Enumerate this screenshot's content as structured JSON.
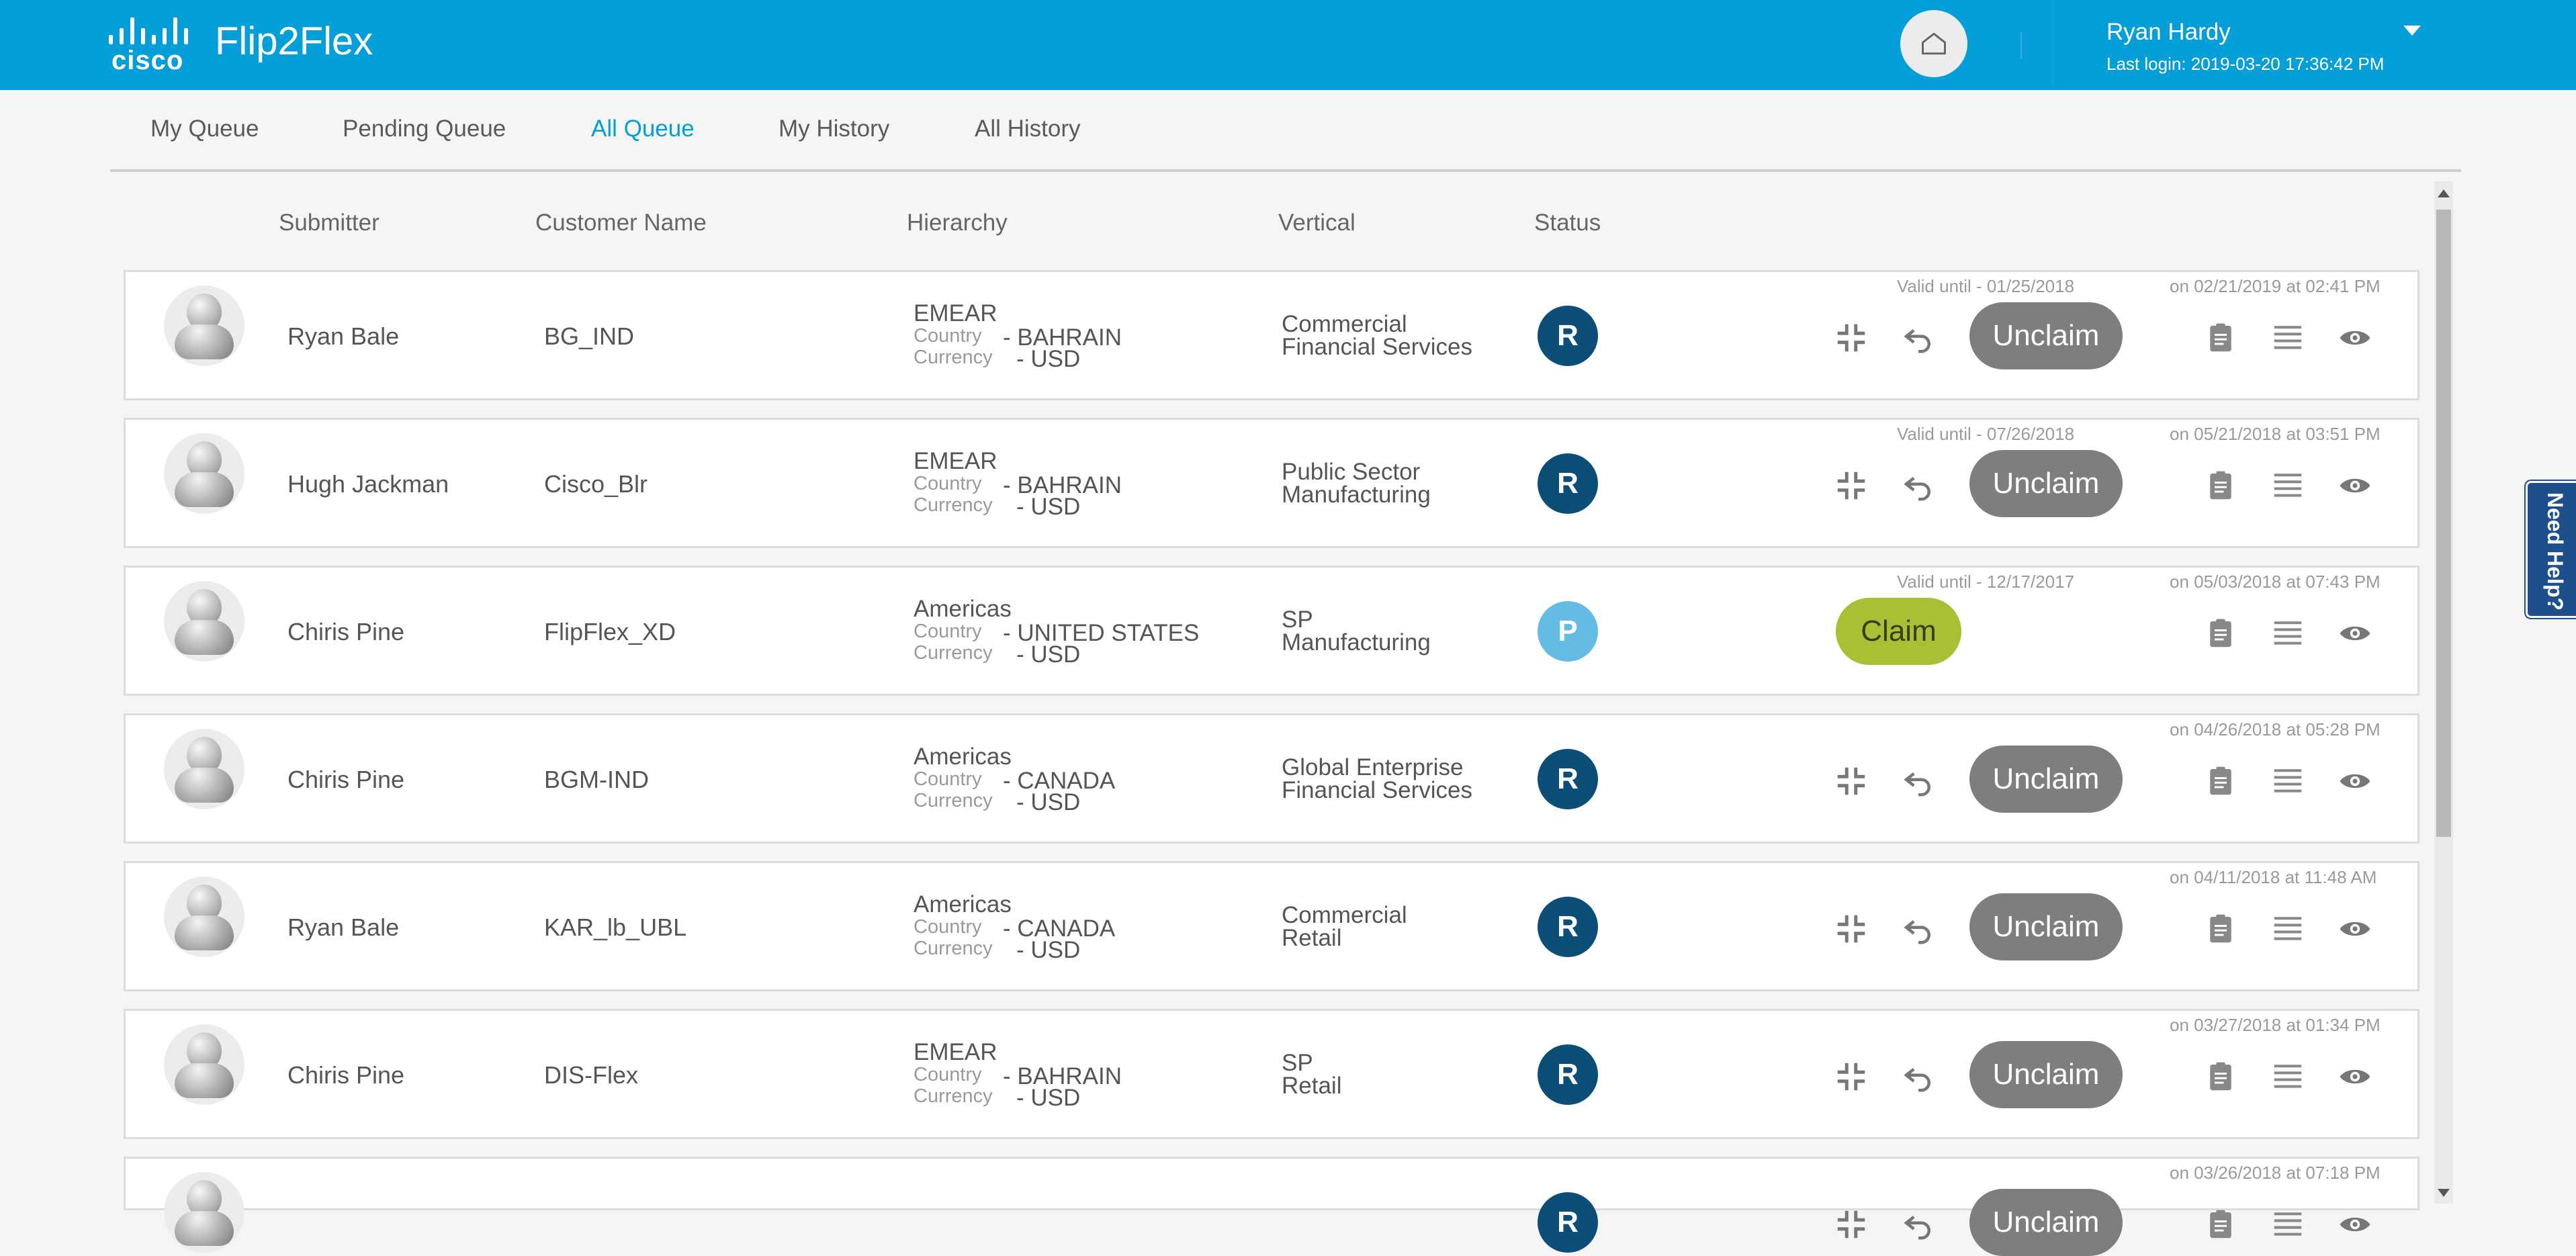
{
  "header": {
    "logo_text": "cisco",
    "app_title": "Flip2Flex",
    "user_name": "Ryan Hardy",
    "last_login": "Last login: 2019-03-20 17:36:42 PM"
  },
  "tabs": [
    {
      "label": "My Queue",
      "active": false
    },
    {
      "label": "Pending Queue",
      "active": false
    },
    {
      "label": "All Queue",
      "active": true
    },
    {
      "label": "My History",
      "active": false
    },
    {
      "label": "All History",
      "active": false
    }
  ],
  "columns": {
    "submitter": "Submitter",
    "customer": "Customer Name",
    "hierarchy": "Hierarchy",
    "vertical": "Vertical",
    "status": "Status"
  },
  "labels": {
    "country": "Country",
    "currency": "Currency",
    "claim": "Claim",
    "unclaim": "Unclaim",
    "need_help": "Need Help?"
  },
  "colors": {
    "header": "#049fd9",
    "status_R": "#0b4f78",
    "status_P": "#64bbe3",
    "claim": "#a8c034",
    "unclaim": "#7e7e7e"
  },
  "rows": [
    {
      "submitter": "Ryan Bale",
      "customer": "BG_IND",
      "region": "EMEAR",
      "country": "- BAHRAIN",
      "currency": "- USD",
      "vertical1": "Commercial",
      "vertical2": "Financial Services",
      "status": "R",
      "valid": "Valid until - 01/25/2018",
      "stamp": "on 02/21/2019 at 02:41 PM",
      "action": "unclaim"
    },
    {
      "submitter": "Hugh Jackman",
      "customer": "Cisco_Blr",
      "region": "EMEAR",
      "country": "- BAHRAIN",
      "currency": "- USD",
      "vertical1": "Public Sector",
      "vertical2": "Manufacturing",
      "status": "R",
      "valid": "Valid until - 07/26/2018",
      "stamp": "on 05/21/2018 at 03:51 PM",
      "action": "unclaim"
    },
    {
      "submitter": "Chiris Pine",
      "customer": "FlipFlex_XD",
      "region": "Americas",
      "country": "- UNITED STATES",
      "currency": "- USD",
      "vertical1": "SP",
      "vertical2": "Manufacturing",
      "status": "P",
      "valid": "Valid until - 12/17/2017",
      "stamp": "on 05/03/2018 at 07:43 PM",
      "action": "claim"
    },
    {
      "submitter": "Chiris Pine",
      "customer": "BGM-IND",
      "region": "Americas",
      "country": "- CANADA",
      "currency": "- USD",
      "vertical1": "Global Enterprise",
      "vertical2": "Financial Services",
      "status": "R",
      "valid": "",
      "stamp": "on 04/26/2018 at 05:28 PM",
      "action": "unclaim"
    },
    {
      "submitter": "Ryan Bale",
      "customer": "KAR_lb_UBL",
      "region": "Americas",
      "country": "- CANADA",
      "currency": "- USD",
      "vertical1": "Commercial",
      "vertical2": "Retail",
      "status": "R",
      "valid": "",
      "stamp": "on 04/11/2018 at 11:48 AM",
      "action": "unclaim"
    },
    {
      "submitter": "Chiris Pine",
      "customer": "DIS-Flex",
      "region": "EMEAR",
      "country": "- BAHRAIN",
      "currency": "- USD",
      "vertical1": "SP",
      "vertical2": "Retail",
      "status": "R",
      "valid": "",
      "stamp": "on 03/27/2018 at 01:34 PM",
      "action": "unclaim"
    },
    {
      "submitter": "",
      "customer": "",
      "region": "",
      "country": "",
      "currency": "",
      "vertical1": "",
      "vertical2": "",
      "status": "R",
      "valid": "",
      "stamp": "on 03/26/2018 at 07:18 PM",
      "action": "unclaim"
    }
  ]
}
